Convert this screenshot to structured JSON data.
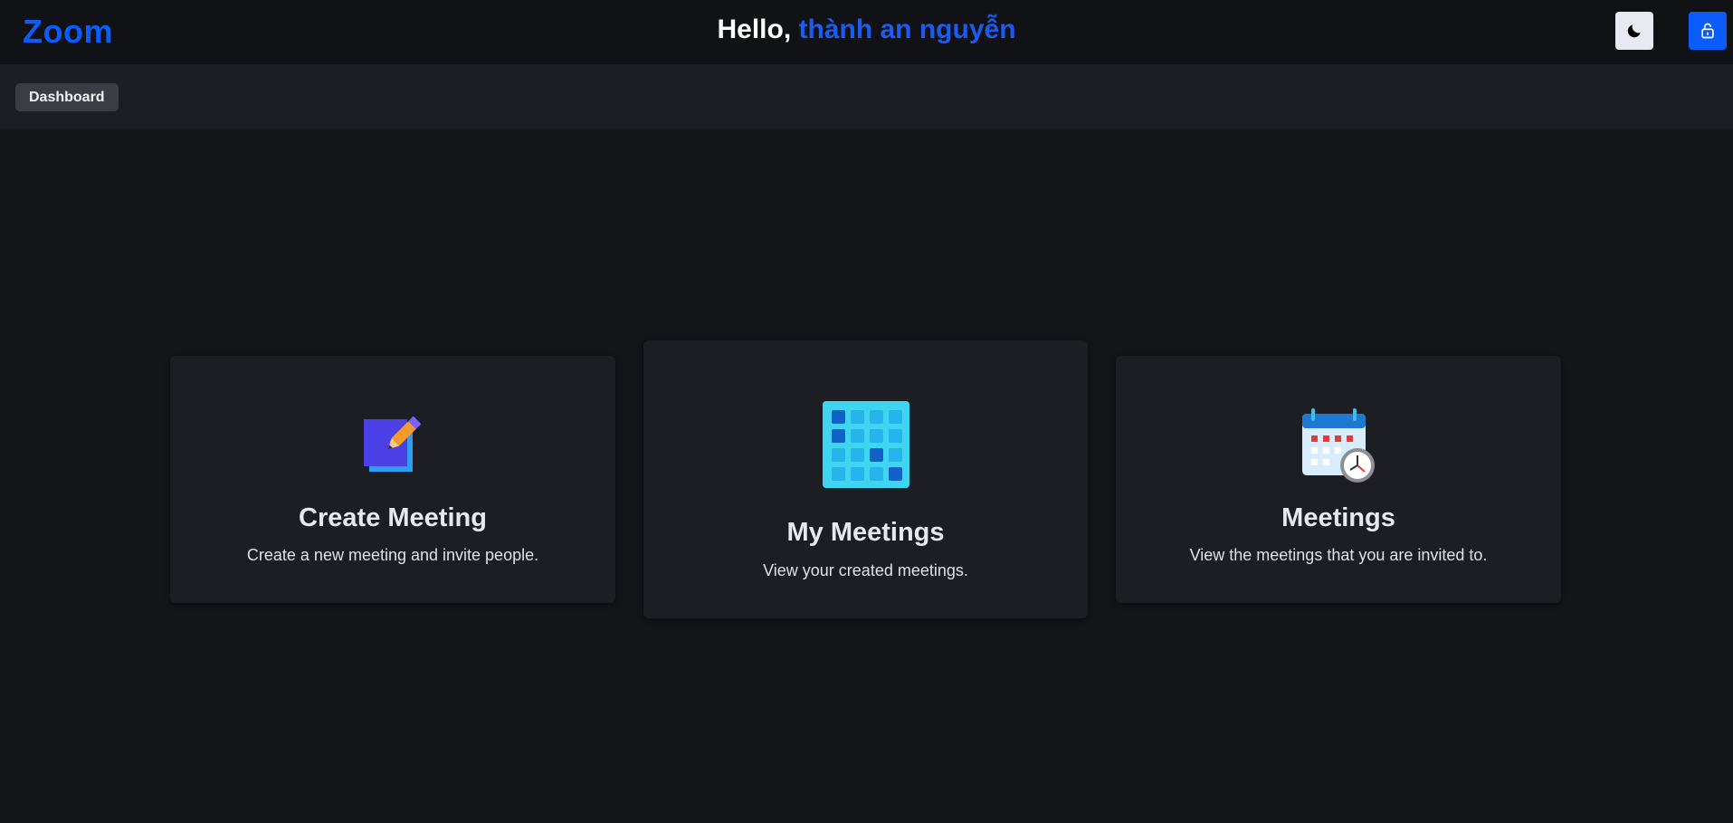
{
  "header": {
    "brand": "Zoom",
    "greeting_prefix": "Hello,",
    "user_name": "thành an nguyễn",
    "theme_toggle_icon": "moon-icon",
    "logout_icon": "unlock-icon"
  },
  "breadcrumb": {
    "items": [
      {
        "label": "Dashboard"
      }
    ]
  },
  "cards": [
    {
      "title": "Create Meeting",
      "description": "Create a new meeting and invite people.",
      "icon": "create-meeting-icon"
    },
    {
      "title": "My Meetings",
      "description": "View your created meetings.",
      "icon": "calendar-grid-icon"
    },
    {
      "title": "Meetings",
      "description": "View the meetings that you are invited to.",
      "icon": "calendar-clock-icon"
    }
  ],
  "colors": {
    "accent": "#0b5cff",
    "background": "#141519",
    "topbar": "#111216",
    "panel": "#1d1e23"
  }
}
